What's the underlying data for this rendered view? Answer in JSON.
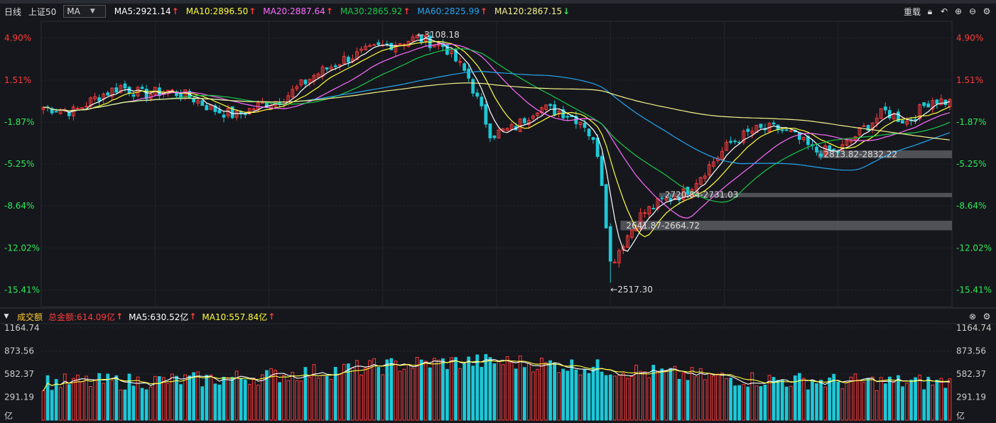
{
  "header": {
    "period": "日线",
    "symbol": "上证50",
    "indicator_select": "MA",
    "reset_label": "重载",
    "ma": [
      {
        "label": "MA5:2921.14",
        "dir": "up",
        "color": "#ffffff"
      },
      {
        "label": "MA10:2896.50",
        "dir": "up",
        "color": "#ffff3c"
      },
      {
        "label": "MA20:2887.64",
        "dir": "up",
        "color": "#ff6bff"
      },
      {
        "label": "MA30:2865.92",
        "dir": "up",
        "color": "#19c84a"
      },
      {
        "label": "MA60:2825.99",
        "dir": "up",
        "color": "#23a5f0"
      },
      {
        "label": "MA120:2867.15",
        "dir": "down",
        "color": "#f2f28c"
      }
    ]
  },
  "volume_header": {
    "name": "成交额",
    "total": "总金额:614.09亿",
    "ma5": "MA5:630.52亿",
    "ma10": "MA10:557.84亿"
  },
  "colors": {
    "up": "#ff3b3b",
    "down": "#1ec8d8",
    "bg": "#16171c",
    "grid": "#2a2d35",
    "axis_pos": "#ff3b3b",
    "axis_neg": "#2ee85a"
  },
  "chart_data": [
    {
      "type": "candlestick",
      "title": "上证50 日线",
      "y_axis_labels": [
        "4.90%",
        "1.51%",
        "-1.87%",
        "-5.25%",
        "-8.64%",
        "-12.02%",
        "-15.41%"
      ],
      "ylim": [
        2460,
        3140
      ],
      "annotations": [
        {
          "text": "←3108.18",
          "x_index": 97,
          "y": 3108.18
        },
        {
          "text": "←2517.30",
          "x_index": 147,
          "y": 2517.3
        },
        {
          "text": "2641.87-2664.72",
          "x_index": 150,
          "y": 2653
        },
        {
          "text": "2720.84-2731.03",
          "x_index": 160,
          "y": 2726
        },
        {
          "text": "2813.82-2832.22",
          "x_index": 202,
          "y": 2823
        }
      ],
      "gap_zones": [
        {
          "low": 2641.87,
          "high": 2664.72,
          "from_index": 150
        },
        {
          "low": 2720.84,
          "high": 2731.03,
          "from_index": 160
        },
        {
          "low": 2813.82,
          "high": 2832.22,
          "from_index": 202
        }
      ],
      "series_names": [
        "MA5",
        "MA10",
        "MA20",
        "MA30",
        "MA60",
        "MA120"
      ],
      "series_colors": [
        "#ffffff",
        "#ffff3c",
        "#ff6bff",
        "#19c84a",
        "#23a5f0",
        "#f2f28c"
      ]
    },
    {
      "type": "bar",
      "title": "成交额",
      "y_axis_labels": [
        "1164.74",
        "873.56",
        "582.37",
        "291.19",
        "亿"
      ],
      "ylim": [
        0,
        1200
      ],
      "series_names": [
        "MA5",
        "MA10"
      ],
      "series_colors": [
        "#ffffff",
        "#ffff3c"
      ]
    }
  ]
}
